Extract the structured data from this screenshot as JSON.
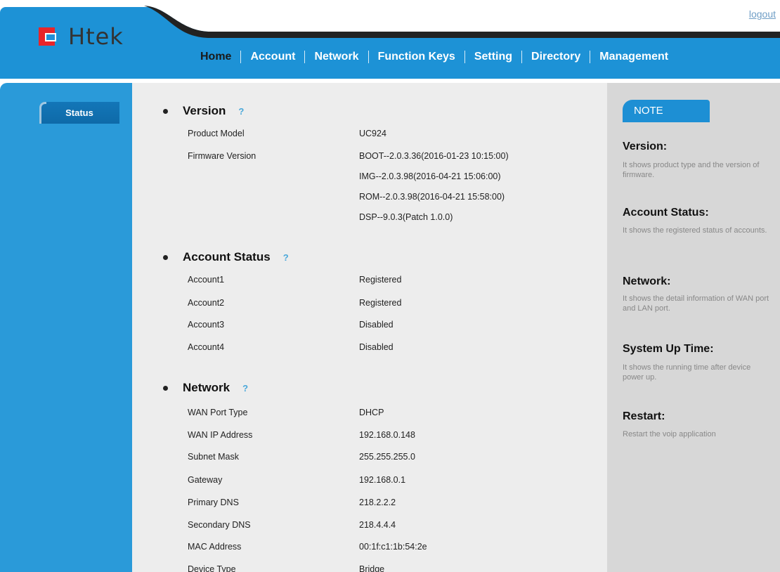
{
  "header": {
    "logo_text": "Htek",
    "logout": "logout",
    "nav": [
      "Home",
      "Account",
      "Network",
      "Function Keys",
      "Setting",
      "Directory",
      "Management"
    ]
  },
  "sidebar": {
    "items": [
      "Status"
    ]
  },
  "sections": {
    "version": {
      "title": "Version",
      "help": "?",
      "rows": [
        {
          "label": "Product Model",
          "value": "UC924"
        },
        {
          "label": "Firmware Version",
          "value": "BOOT--2.0.3.36(2016-01-23 10:15:00)"
        },
        {
          "label": "",
          "value": "IMG--2.0.3.98(2016-04-21 15:06:00)"
        },
        {
          "label": "",
          "value": "ROM--2.0.3.98(2016-04-21 15:58:00)"
        },
        {
          "label": "",
          "value": "DSP--9.0.3(Patch 1.0.0)"
        }
      ]
    },
    "account": {
      "title": "Account Status",
      "help": "?",
      "rows": [
        {
          "label": "Account1",
          "value": "Registered"
        },
        {
          "label": "Account2",
          "value": "Registered"
        },
        {
          "label": "Account3",
          "value": "Disabled"
        },
        {
          "label": "Account4",
          "value": "Disabled"
        }
      ]
    },
    "network": {
      "title": "Network",
      "help": "?",
      "rows": [
        {
          "label": "WAN Port Type",
          "value": "DHCP"
        },
        {
          "label": "WAN IP Address",
          "value": "192.168.0.148"
        },
        {
          "label": "Subnet Mask",
          "value": "255.255.255.0"
        },
        {
          "label": "Gateway",
          "value": "192.168.0.1"
        },
        {
          "label": "Primary DNS",
          "value": "218.2.2.2"
        },
        {
          "label": "Secondary DNS",
          "value": "218.4.4.4"
        },
        {
          "label": "MAC Address",
          "value": "00:1f:c1:1b:54:2e"
        },
        {
          "label": "Device Type",
          "value": "Bridge"
        }
      ]
    }
  },
  "note": {
    "tab": "NOTE",
    "items": [
      {
        "heading": "Version:",
        "text": "It shows product type and the version of firmware."
      },
      {
        "heading": "Account Status:",
        "text": "It shows the registered status of accounts."
      },
      {
        "heading": "Network:",
        "text": "It shows the detail information of WAN port and LAN port."
      },
      {
        "heading": "System Up Time:",
        "text": "It shows the running time after device power up."
      },
      {
        "heading": "Restart:",
        "text": "Restart the voip application"
      }
    ]
  },
  "colors": {
    "brand_blue": "#1d92d6",
    "logo_red": "#e8252a",
    "note_bg": "#d7d7d7",
    "main_bg": "#ededed"
  }
}
